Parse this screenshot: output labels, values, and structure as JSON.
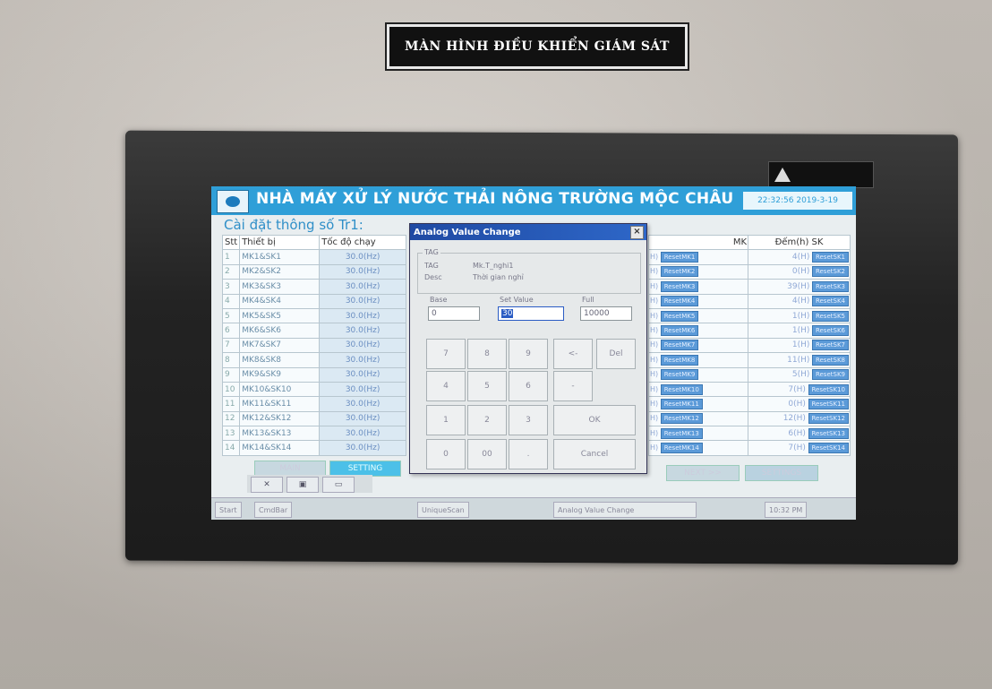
{
  "plaque": {
    "text": "MÀN HÌNH ĐIỀU KHIỂN GIÁM SÁT"
  },
  "header": {
    "title": "NHÀ MÁY XỬ LÝ NƯỚC THẢI NÔNG TRƯỜNG MỘC CHÂU",
    "time": "22:32:56  2019-3-19"
  },
  "subtitle": "Cài đặt thông số Tr1:",
  "left_table": {
    "headers": [
      "Stt",
      "Thiết bị",
      "Tốc độ chạy"
    ],
    "rows": [
      {
        "stt": "1",
        "device": "MK1&SK1",
        "speed": "30.0(Hz)"
      },
      {
        "stt": "2",
        "device": "MK2&SK2",
        "speed": "30.0(Hz)"
      },
      {
        "stt": "3",
        "device": "MK3&SK3",
        "speed": "30.0(Hz)"
      },
      {
        "stt": "4",
        "device": "MK4&SK4",
        "speed": "30.0(Hz)"
      },
      {
        "stt": "5",
        "device": "MK5&SK5",
        "speed": "30.0(Hz)"
      },
      {
        "stt": "6",
        "device": "MK6&SK6",
        "speed": "30.0(Hz)"
      },
      {
        "stt": "7",
        "device": "MK7&SK7",
        "speed": "30.0(Hz)"
      },
      {
        "stt": "8",
        "device": "MK8&SK8",
        "speed": "30.0(Hz)"
      },
      {
        "stt": "9",
        "device": "MK9&SK9",
        "speed": "30.0(Hz)"
      },
      {
        "stt": "10",
        "device": "MK10&SK10",
        "speed": "30.0(Hz)"
      },
      {
        "stt": "11",
        "device": "MK11&SK11",
        "speed": "30.0(Hz)"
      },
      {
        "stt": "12",
        "device": "MK12&SK12",
        "speed": "30.0(Hz)"
      },
      {
        "stt": "13",
        "device": "MK13&SK13",
        "speed": "30.0(Hz)"
      },
      {
        "stt": "14",
        "device": "MK14&SK14",
        "speed": "30.0(Hz)"
      }
    ]
  },
  "right_table": {
    "headers": [
      "MK",
      "Đếm(h) SK"
    ],
    "rows": [
      {
        "mk_prefix": "H)",
        "mk_btn": "ResetMK1",
        "sk_hours": "4(H)",
        "sk_btn": "ResetSK1"
      },
      {
        "mk_prefix": "H)",
        "mk_btn": "ResetMK2",
        "sk_hours": "0(H)",
        "sk_btn": "ResetSK2"
      },
      {
        "mk_prefix": "H)",
        "mk_btn": "ResetMK3",
        "sk_hours": "39(H)",
        "sk_btn": "ResetSK3"
      },
      {
        "mk_prefix": "H)",
        "mk_btn": "ResetMK4",
        "sk_hours": "4(H)",
        "sk_btn": "ResetSK4"
      },
      {
        "mk_prefix": "H)",
        "mk_btn": "ResetMK5",
        "sk_hours": "1(H)",
        "sk_btn": "ResetSK5"
      },
      {
        "mk_prefix": "H)",
        "mk_btn": "ResetMK6",
        "sk_hours": "1(H)",
        "sk_btn": "ResetSK6"
      },
      {
        "mk_prefix": "H)",
        "mk_btn": "ResetMK7",
        "sk_hours": "1(H)",
        "sk_btn": "ResetSK7"
      },
      {
        "mk_prefix": "H)",
        "mk_btn": "ResetMK8",
        "sk_hours": "11(H)",
        "sk_btn": "ResetSK8"
      },
      {
        "mk_prefix": "H)",
        "mk_btn": "ResetMK9",
        "sk_hours": "5(H)",
        "sk_btn": "ResetSK9"
      },
      {
        "mk_prefix": "H)",
        "mk_btn": "ResetMK10",
        "sk_hours": "7(H)",
        "sk_btn": "ResetSK10"
      },
      {
        "mk_prefix": "H)",
        "mk_btn": "ResetMK11",
        "sk_hours": "0(H)",
        "sk_btn": "ResetSK11"
      },
      {
        "mk_prefix": "H)",
        "mk_btn": "ResetMK12",
        "sk_hours": "12(H)",
        "sk_btn": "ResetSK12"
      },
      {
        "mk_prefix": "H)",
        "mk_btn": "ResetMK13",
        "sk_hours": "6(H)",
        "sk_btn": "ResetSK13"
      },
      {
        "mk_prefix": "H)",
        "mk_btn": "ResetMK14",
        "sk_hours": "7(H)",
        "sk_btn": "ResetSK14"
      }
    ]
  },
  "nav": {
    "main": "MAIN",
    "setting": "SETTING",
    "next": "NEXT >>",
    "right": "SETTINGS"
  },
  "taskbar": {
    "start": "Start",
    "item1": "CmdBar",
    "item2": "UniqueScan",
    "item3": "Analog Value Change",
    "clock": "10:32 PM"
  },
  "dialog": {
    "title": "Analog Value Change",
    "close": "×",
    "tag_group": "TAG",
    "tag_label": "TAG",
    "tag_value": "Mk.T_nghi1",
    "desc_label": "Desc",
    "desc_value": "Thời gian nghỉ",
    "base_label": "Base",
    "base_value": "0",
    "set_label": "Set Value",
    "set_value": "30",
    "full_label": "Full",
    "full_value": "10000",
    "keys": {
      "k7": "7",
      "k8": "8",
      "k9": "9",
      "back": "<-",
      "del": "Del",
      "k4": "4",
      "k5": "5",
      "k6": "6",
      "minus": "-",
      "k1": "1",
      "k2": "2",
      "k3": "3",
      "ok": "OK",
      "k0": "0",
      "k00": "00",
      "dot": ".",
      "cancel": "Cancel"
    }
  },
  "colors": {
    "header_bg": "#2f9fd8",
    "dialog_title": "#1f4aa3",
    "screen_bg": "#e9eef0"
  }
}
